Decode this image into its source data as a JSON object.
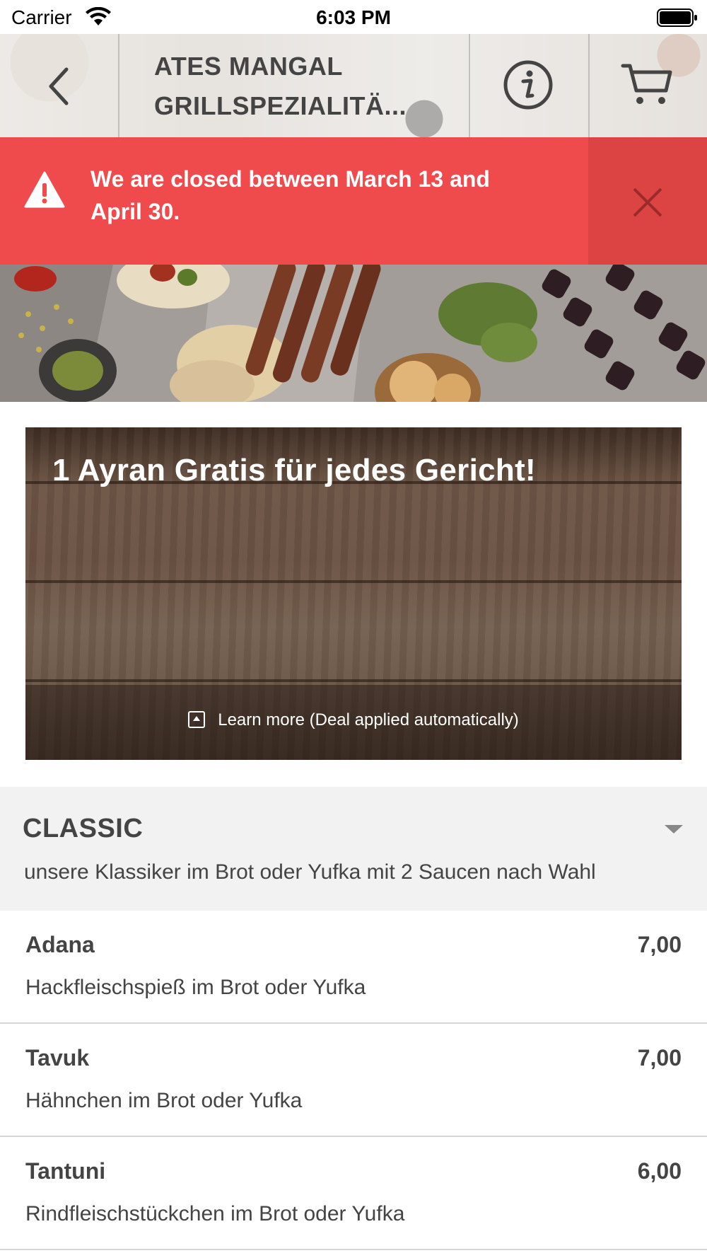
{
  "status_bar": {
    "carrier": "Carrier",
    "time": "6:03 PM"
  },
  "header": {
    "title_line1": "ATES MANGAL",
    "title_line2": "GRILLSPEZIALITÄ...",
    "back_icon": "chevron-left-icon",
    "info_icon": "info-icon",
    "cart_icon": "cart-icon"
  },
  "alert": {
    "line1": "We are closed between March 13 and",
    "line2": "April 30.",
    "color": "#ef4b4c"
  },
  "deal": {
    "title": "1 Ayran Gratis für jedes Gericht!",
    "learn_more": "Learn more (Deal applied automatically)"
  },
  "category": {
    "title": "CLASSIC",
    "description": "unsere Klassiker im Brot oder Yufka mit 2 Saucen nach Wahl"
  },
  "items": [
    {
      "name": "Adana",
      "price": "7,00",
      "description": "Hackfleischspieß im Brot oder Yufka"
    },
    {
      "name": "Tavuk",
      "price": "7,00",
      "description": "Hähnchen im Brot oder Yufka"
    },
    {
      "name": "Tantuni",
      "price": "6,00",
      "description": "Rindfleischstückchen im Brot oder Yufka"
    }
  ]
}
